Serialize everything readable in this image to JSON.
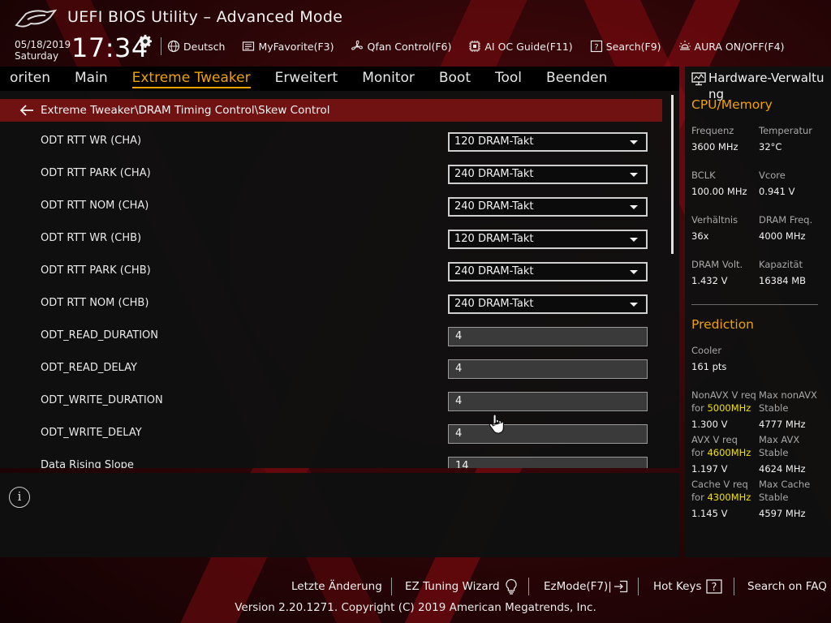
{
  "header": {
    "title": "UEFI BIOS Utility – Advanced Mode",
    "date": "05/18/2019",
    "day": "Saturday",
    "time": "17:34",
    "tools": [
      {
        "label": "Deutsch",
        "icon": "globe-icon"
      },
      {
        "label": "MyFavorite(F3)",
        "icon": "favorite-icon"
      },
      {
        "label": "Qfan Control(F6)",
        "icon": "fan-icon"
      },
      {
        "label": "AI OC Guide(F11)",
        "icon": "ai-guide-icon"
      },
      {
        "label": "Search(F9)",
        "icon": "search-icon"
      },
      {
        "label": "AURA ON/OFF(F4)",
        "icon": "aura-icon"
      }
    ]
  },
  "nav": {
    "tabs": [
      "oriten",
      "Main",
      "Extreme Tweaker",
      "Erweitert",
      "Monitor",
      "Boot",
      "Tool",
      "Beenden"
    ],
    "active": "Extreme Tweaker"
  },
  "breadcrumb": "Extreme Tweaker\\DRAM Timing Control\\Skew Control",
  "settings": [
    {
      "label": "ODT RTT WR (CHA)",
      "type": "dropdown",
      "value": "120 DRAM-Takt"
    },
    {
      "label": "ODT RTT PARK (CHA)",
      "type": "dropdown",
      "value": "240 DRAM-Takt"
    },
    {
      "label": "ODT RTT NOM (CHA)",
      "type": "dropdown",
      "value": "240 DRAM-Takt"
    },
    {
      "label": "ODT RTT WR (CHB)",
      "type": "dropdown",
      "value": "120 DRAM-Takt"
    },
    {
      "label": "ODT RTT PARK (CHB)",
      "type": "dropdown",
      "value": "240 DRAM-Takt"
    },
    {
      "label": "ODT RTT NOM (CHB)",
      "type": "dropdown",
      "value": "240 DRAM-Takt"
    },
    {
      "label": "ODT_READ_DURATION",
      "type": "input",
      "value": "4"
    },
    {
      "label": "ODT_READ_DELAY",
      "type": "input",
      "value": "4"
    },
    {
      "label": "ODT_WRITE_DURATION",
      "type": "input",
      "value": "4"
    },
    {
      "label": "ODT_WRITE_DELAY",
      "type": "input",
      "value": "4"
    },
    {
      "label": "Data Rising Slope",
      "type": "input",
      "value": "14"
    }
  ],
  "hardware": {
    "title": "Hardware-Verwaltung",
    "cpu_memory": {
      "heading": "CPU/Memory",
      "items": [
        {
          "key": "Frequenz",
          "value": "3600 MHz"
        },
        {
          "key": "Temperatur",
          "value": "32°C"
        },
        {
          "key": "BCLK",
          "value": "100.00 MHz"
        },
        {
          "key": "Vcore",
          "value": "0.941 V"
        },
        {
          "key": "Verhältnis",
          "value": "36x"
        },
        {
          "key": "DRAM Freq.",
          "value": "4000 MHz"
        },
        {
          "key": "DRAM Volt.",
          "value": "1.432 V"
        },
        {
          "key": "Kapazität",
          "value": "16384 MB"
        }
      ]
    },
    "prediction": {
      "heading": "Prediction",
      "cooler_label": "Cooler",
      "cooler_value": "161 pts",
      "rows": [
        {
          "left_line1": "NonAVX V req",
          "left_prefix": "for ",
          "left_freq": "5000MHz",
          "left_value": "1.300 V",
          "right_line1": "Max nonAVX",
          "right_line2": "Stable",
          "right_value": "4777 MHz"
        },
        {
          "left_line1": "AVX V req",
          "left_prefix": "for ",
          "left_freq": "4600MHz",
          "left_value": "1.197 V",
          "right_line1": "Max AVX",
          "right_line2": "Stable",
          "right_value": "4624 MHz"
        },
        {
          "left_line1": "Cache V req",
          "left_prefix": "for ",
          "left_freq": "4300MHz",
          "left_value": "1.145 V",
          "right_line1": "Max Cache",
          "right_line2": "Stable",
          "right_value": "4597 MHz"
        }
      ]
    }
  },
  "footer": {
    "items": [
      "Letzte Änderung",
      "EZ Tuning Wizard",
      "EzMode(F7)|",
      "Hot Keys",
      "Search on FAQ"
    ],
    "version": "Version 2.20.1271. Copyright (C) 2019 American Megatrends, Inc."
  }
}
